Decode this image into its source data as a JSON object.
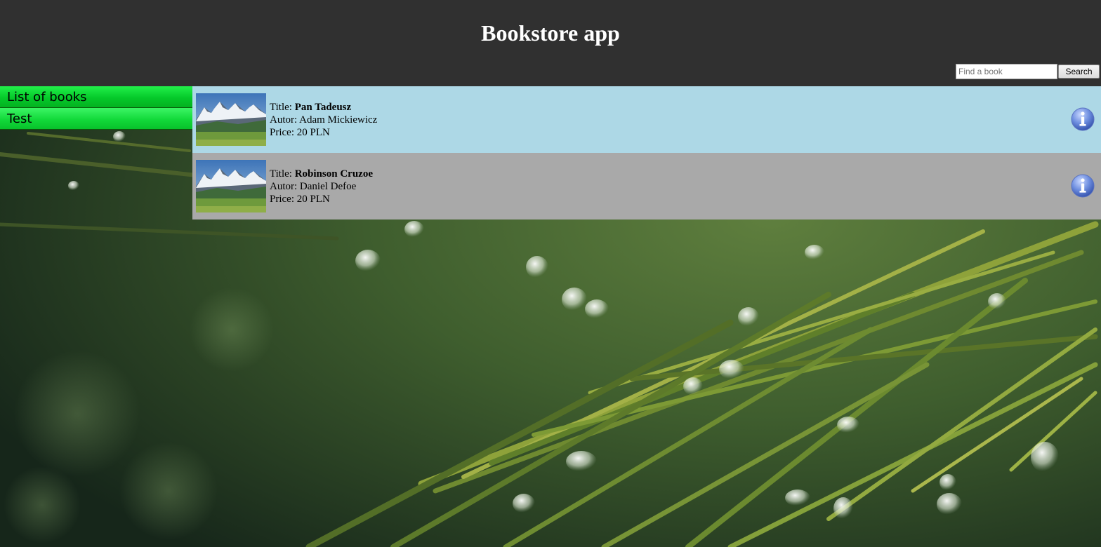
{
  "header": {
    "title": "Bookstore app",
    "search": {
      "placeholder": "Find a book",
      "value": "",
      "button_label": "Search"
    }
  },
  "sidebar": {
    "items": [
      {
        "label": "List of books"
      },
      {
        "label": "Test"
      }
    ]
  },
  "books": [
    {
      "title_label": "Title:",
      "title": "Pan Tadeusz",
      "author_label": "Autor:",
      "author": "Adam Mickiewicz",
      "price_label": "Price:",
      "price": "20 PLN",
      "thumbnail_icon": "mountain-landscape",
      "action_icon": "info-icon"
    },
    {
      "title_label": "Title:",
      "title": "Robinson Cruzoe",
      "author_label": "Autor:",
      "author": "Daniel Defoe",
      "price_label": "Price:",
      "price": "20 PLN",
      "thumbnail_icon": "mountain-landscape",
      "action_icon": "info-icon"
    }
  ],
  "colors": {
    "header_bg": "#303030",
    "nav_green": "#05c92a",
    "row_highlight": "#add8e6",
    "row_default": "#a9a9a9",
    "info_blue": "#5b7fd6"
  }
}
